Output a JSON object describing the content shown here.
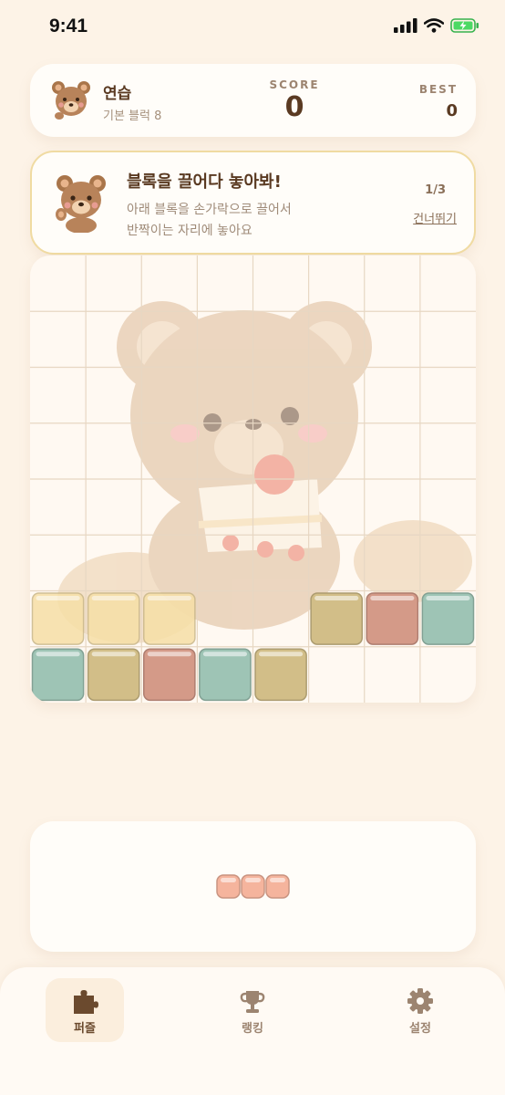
{
  "status_bar": {
    "time": "9:41"
  },
  "header": {
    "mode_title": "연습",
    "mode_subtitle": "기본 블럭 8",
    "score_label": "SCORE",
    "score_value": "0",
    "best_label": "BEST",
    "best_value": "0"
  },
  "tutorial": {
    "title": "블록을 끌어다 놓아봐!",
    "line1": "아래 블록을 손가락으로 끌어서",
    "line2": "반짝이는 자리에 놓아요",
    "step": "1/3",
    "skip_label": "건너뛰기"
  },
  "board": {
    "rows": 8,
    "cols": 8,
    "cells": [
      {
        "row": 6,
        "col": 0,
        "color": "ghost"
      },
      {
        "row": 6,
        "col": 1,
        "color": "ghost"
      },
      {
        "row": 6,
        "col": 2,
        "color": "ghost"
      },
      {
        "row": 6,
        "col": 5,
        "color": "olive"
      },
      {
        "row": 6,
        "col": 6,
        "color": "rose"
      },
      {
        "row": 6,
        "col": 7,
        "color": "teal"
      },
      {
        "row": 7,
        "col": 0,
        "color": "teal"
      },
      {
        "row": 7,
        "col": 1,
        "color": "olive"
      },
      {
        "row": 7,
        "col": 2,
        "color": "rose"
      },
      {
        "row": 7,
        "col": 3,
        "color": "teal"
      },
      {
        "row": 7,
        "col": 4,
        "color": "olive"
      }
    ]
  },
  "tray": {
    "piece": {
      "cells": 3,
      "color": "peach"
    }
  },
  "tabs": [
    {
      "label": "퍼즐",
      "icon": "puzzle-icon",
      "active": true
    },
    {
      "label": "랭킹",
      "icon": "trophy-icon",
      "active": false
    },
    {
      "label": "설정",
      "icon": "gear-icon",
      "active": false
    }
  ],
  "colors": {
    "background": "#fdf3e7",
    "teal": "#9ec4b5",
    "olive": "#d2be88",
    "rose": "#d49a88",
    "ghost": "#f6dfa6",
    "peach": "#f5b49d",
    "tab_active": "#6b4a2e",
    "tab_inactive": "#9c8470"
  }
}
